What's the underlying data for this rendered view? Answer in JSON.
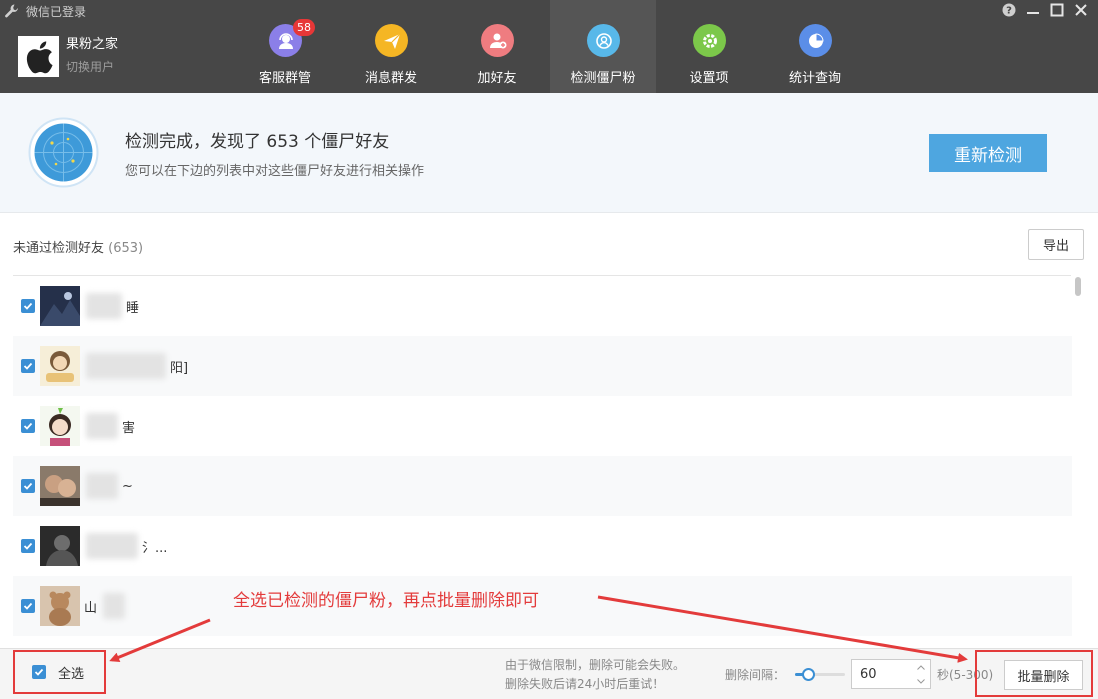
{
  "window": {
    "title": "微信已登录",
    "controls": [
      "help-icon",
      "minimize-icon",
      "maximize-icon",
      "close-icon"
    ]
  },
  "account": {
    "name": "果粉之家",
    "switch_label": "切换用户",
    "logo_icon": "apple-logo-icon"
  },
  "nav": {
    "items": [
      {
        "label": "客服群管",
        "icon": "headset-icon",
        "color": "#8b7fe8",
        "badge": "58"
      },
      {
        "label": "消息群发",
        "icon": "paper-plane-icon",
        "color": "#f5b624"
      },
      {
        "label": "加好友",
        "icon": "add-user-icon",
        "color": "#ef7c80"
      },
      {
        "label": "检测僵尸粉",
        "icon": "detect-icon",
        "color": "#58b8e9",
        "active": true
      },
      {
        "label": "设置项",
        "icon": "gear-icon",
        "color": "#7cc84a"
      },
      {
        "label": "统计查询",
        "icon": "pie-chart-icon",
        "color": "#5b8ee8"
      }
    ]
  },
  "banner": {
    "headline": "检测完成，发现了 653 个僵尸好友",
    "subtext": "您可以在下边的列表中对这些僵尸好友进行相关操作",
    "recheck_label": "重新检测",
    "radar_icon": "radar-icon"
  },
  "list": {
    "title": "未通过检测好友",
    "count": "(653)",
    "export_label": "导出",
    "rows": [
      {
        "visible_text": "睡",
        "checked": true
      },
      {
        "visible_text": "阳]",
        "checked": true
      },
      {
        "visible_text": "害",
        "checked": true
      },
      {
        "visible_text": "~",
        "checked": true
      },
      {
        "visible_text": "氵...",
        "checked": true
      },
      {
        "visible_text": "山",
        "checked": true
      }
    ]
  },
  "annotation": {
    "text": "全选已检测的僵尸粉，再点批量删除即可",
    "color": "#e33b3b"
  },
  "footer": {
    "select_all_label": "全选",
    "select_all_checked": true,
    "notice_line1": "由于微信限制，删除可能会失败。",
    "notice_line2": "删除失败后请24小时后重试！",
    "interval_label": "删除间隔：",
    "interval_value": "60",
    "interval_slider_fraction": 0.2,
    "range_label": "秒(5-300)",
    "batch_delete_label": "批量删除"
  },
  "colors": {
    "topbar": "#474747",
    "accent_blue": "#4ea6e0",
    "checkbox_blue": "#3b8fd4",
    "annotation_red": "#e33b3b"
  }
}
